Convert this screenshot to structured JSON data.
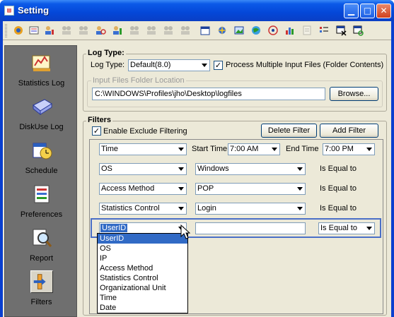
{
  "window": {
    "title": "Setting",
    "app_icon": "app-icon",
    "controls": [
      "minimize-icon",
      "maximize-icon",
      "close-icon"
    ]
  },
  "toolbar": {
    "icons": [
      "gear-icon",
      "log-icon",
      "user-chart-icon",
      "users-icon",
      "users-icon",
      "user-search-icon",
      "user-chart-icon",
      "users-icon",
      "users-icon",
      "users-icon",
      "calendar-icon",
      "spark-icon",
      "image-icon",
      "globe-icon",
      "network-icon",
      "bar-chart-icon",
      "document-icon",
      "list-icon",
      "window-close-icon",
      "window-refresh-icon"
    ]
  },
  "nav": {
    "items": [
      {
        "label": "Statistics Log",
        "icon": "statistics-log-icon"
      },
      {
        "label": "DiskUse Log",
        "icon": "disk-icon"
      },
      {
        "label": "Schedule",
        "icon": "calendar-clock-icon"
      },
      {
        "label": "Preferences",
        "icon": "preferences-icon"
      },
      {
        "label": "Report",
        "icon": "report-magnifier-icon"
      },
      {
        "label": "Filters",
        "icon": "filters-icon"
      }
    ]
  },
  "log_type": {
    "title": "Log Type:",
    "log_type_label": "Log Type:",
    "log_type_value": "Default(8.0)",
    "process_multiple_checked": true,
    "process_multiple_label": "Process Multiple Input Files (Folder Contents)",
    "folder_group_label": "Input Files Folder Location",
    "folder_path": "C:\\WINDOWS\\Profiles\\jho\\Desktop\\logfiles",
    "browse_label": "Browse..."
  },
  "filters": {
    "title": "Filters",
    "enable_exclude_checked": true,
    "enable_exclude_label": "Enable Exclude Filtering",
    "delete_label": "Delete Filter",
    "add_label": "Add Filter",
    "time_row": {
      "field": "Time",
      "start_label": "Start Time",
      "start_value": "7:00 AM",
      "end_label": "End Time",
      "end_value": "7:00 PM"
    },
    "rows": [
      {
        "field": "OS",
        "value": "Windows",
        "operator": "Is Equal to"
      },
      {
        "field": "Access Method",
        "value": "POP",
        "operator": "Is Equal to"
      },
      {
        "field": "Statistics Control",
        "value": "Login",
        "operator": "Is Equal to"
      }
    ],
    "active_row": {
      "field": "UserID",
      "value": "",
      "operator": "Is Equal to"
    },
    "dropdown_options": [
      "UserID",
      "OS",
      "IP",
      "Access Method",
      "Statistics Control",
      "Organizational Unit",
      "Time",
      "Date"
    ],
    "dropdown_highlighted": "UserID"
  }
}
